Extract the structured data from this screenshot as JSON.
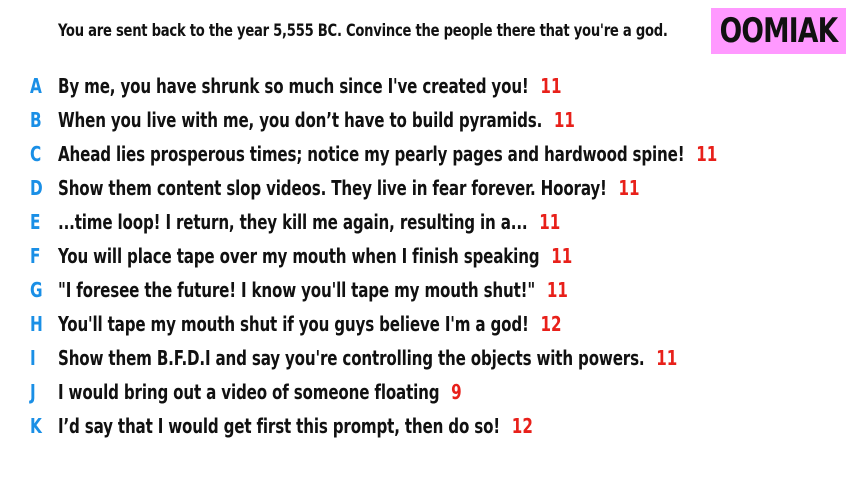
{
  "header": {
    "prompt": "You are sent back to the year 5,555 BC. Convince the people there that you're a god.",
    "badge": "OOMIAK"
  },
  "colors": {
    "letter": "#1a8fe6",
    "score": "#e8201a",
    "badge_bg": "#ff99ff",
    "text": "#111111"
  },
  "answers": [
    {
      "letter": "A",
      "text": "By me, you have shrunk so much since I've created you!",
      "score": "11"
    },
    {
      "letter": "B",
      "text": "When you live with me, you don’t have to build pyramids.",
      "score": "11"
    },
    {
      "letter": "C",
      "text": "Ahead lies prosperous times; notice my pearly pages and hardwood spine!",
      "score": "11"
    },
    {
      "letter": "D",
      "text": "Show them content slop videos. They live in fear forever. Hooray!",
      "score": "11"
    },
    {
      "letter": "E",
      "text": "...time loop! I return, they kill me again, resulting in a...",
      "score": "11"
    },
    {
      "letter": "F",
      "text": "You will place tape over my mouth when I finish speaking",
      "score": "11"
    },
    {
      "letter": "G",
      "text": "\"I foresee the future! I know you'll tape my mouth shut!\"",
      "score": "11"
    },
    {
      "letter": "H",
      "text": "You'll tape my mouth shut if you guys believe I'm a god!",
      "score": "12"
    },
    {
      "letter": "I",
      "text": "Show them B.F.D.I and say you're controlling the objects with powers.",
      "score": "11"
    },
    {
      "letter": "J",
      "text": "I would bring out a video of someone floating",
      "score": "9"
    },
    {
      "letter": "K",
      "text": "I’d say that I would get first this prompt, then do so!",
      "score": "12"
    }
  ]
}
